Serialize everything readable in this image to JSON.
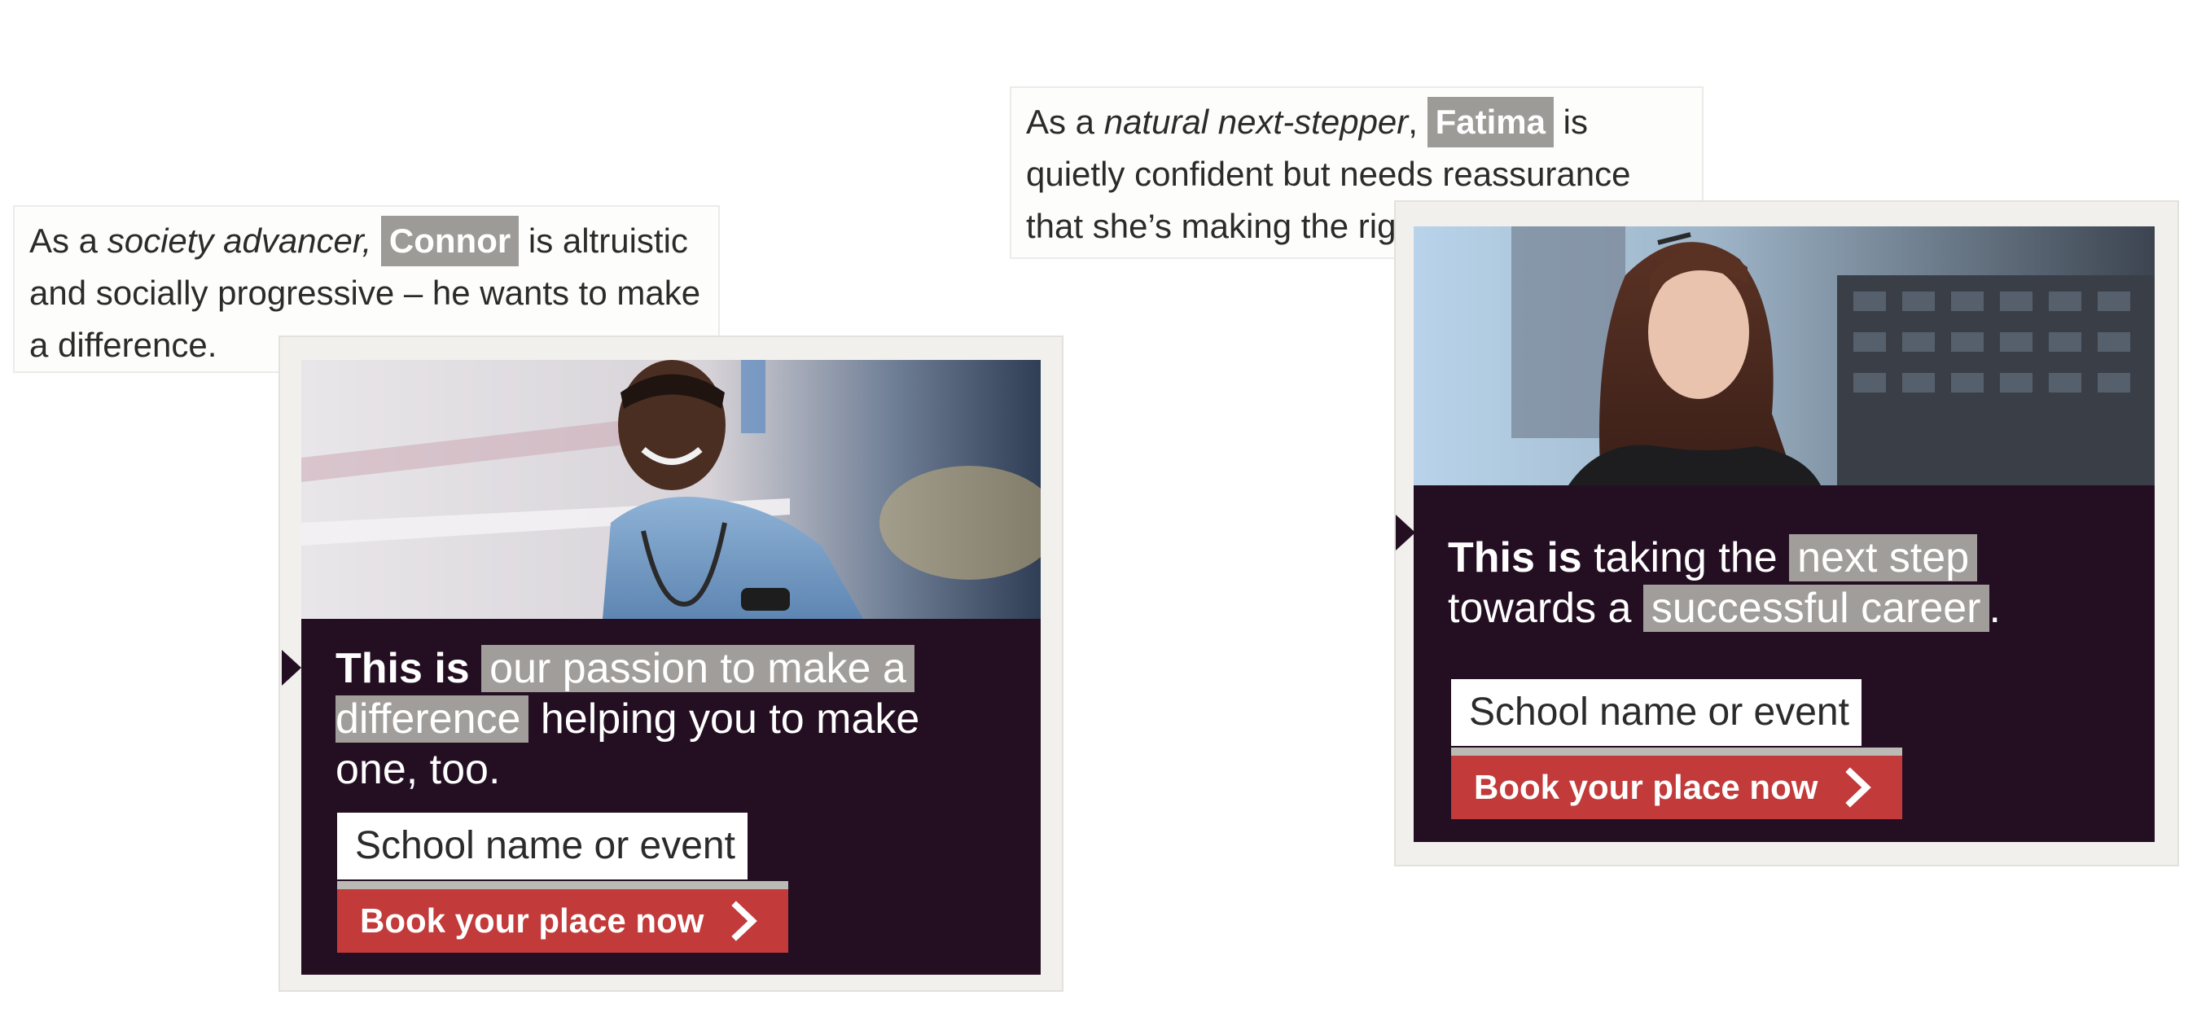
{
  "left_card": {
    "caption": {
      "prefix": "As a ",
      "persona": "society advancer,",
      "name": "Connor",
      "suffix": " is altruistic and socially progressive – he wants to make a difference."
    },
    "headline": {
      "bold": "This is",
      "highlight_1": "our passion to make a",
      "highlight_2": "difference",
      "rest": " helping you to make one, too."
    },
    "school_field": "School name or event",
    "cta": "Book your place now"
  },
  "right_card": {
    "caption": {
      "prefix": "As a ",
      "persona": "natural next-stepper",
      "comma": ", ",
      "name": "Fatima",
      "suffix": " is quietly confident but needs reassurance that she’s making the right move."
    },
    "headline": {
      "bold": "This is",
      "plain_1": " taking the ",
      "highlight_1": "next step",
      "plain_2": "towards a ",
      "highlight_2": "successful career",
      "end": "."
    },
    "school_field": "School name or event",
    "cta": "Book your place now"
  },
  "colors": {
    "panel": "#240f22",
    "cta": "#c23a3a",
    "highlight": "#a09d9a"
  },
  "icons": [
    "chevron-right-icon",
    "chevron-right-icon"
  ]
}
